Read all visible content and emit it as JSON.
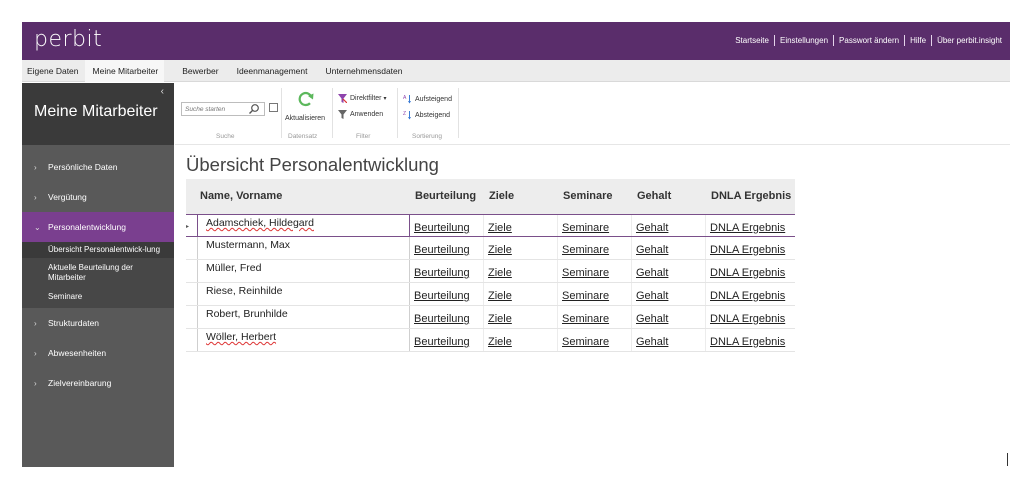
{
  "app": {
    "logo": "perbit",
    "top_links": [
      "Startseite",
      "Einstellungen",
      "Passwort ändern",
      "Hilfe",
      "Über perbit.insight"
    ]
  },
  "module_tabs": [
    {
      "label": "Eigene Daten",
      "active": false
    },
    {
      "label": "Meine Mitarbeiter",
      "active": true
    },
    {
      "label": "Bewerber",
      "active": false
    },
    {
      "label": "Ideenmanagement",
      "active": false
    },
    {
      "label": "Unternehmensdaten",
      "active": false
    }
  ],
  "sidebar": {
    "title": "Meine Mitarbeiter",
    "items": [
      {
        "label": "Persönliche Daten",
        "icon": "chevron-right"
      },
      {
        "label": "Vergütung",
        "icon": "chevron-right"
      },
      {
        "label": "Personalentwicklung",
        "icon": "chevron-down",
        "active": true
      },
      {
        "label": "Strukturdaten",
        "icon": "chevron-right"
      },
      {
        "label": "Abwesenheiten",
        "icon": "chevron-right"
      },
      {
        "label": "Zielvereinbarung",
        "icon": "chevron-right"
      }
    ],
    "subitems": [
      {
        "label": "Übersicht Personalentwick-lung",
        "active": true
      },
      {
        "label": "Aktuelle Beurteilung der Mitarbeiter",
        "active": false
      },
      {
        "label": "Seminare",
        "active": false
      }
    ]
  },
  "ribbon": {
    "search_placeholder": "Suche starten",
    "groups": {
      "search": "Suche",
      "record": "Datensatz",
      "filter": "Filter",
      "sort": "Sortierung"
    },
    "refresh_label": "Aktualisieren",
    "direct_filter_label": "Direktfilter",
    "apply_label": "Anwenden",
    "ascending_label": "Aufsteigend",
    "descending_label": "Absteigend"
  },
  "main": {
    "title": "Übersicht Personalentwicklung",
    "columns": [
      "Name, Vorname",
      "Beurteilung",
      "Ziele",
      "Seminare",
      "Gehalt",
      "DNLA Ergebnis"
    ],
    "rows": [
      {
        "name": "Adamschiek, Hildegard",
        "links": [
          "Beurteilung",
          "Ziele",
          "Seminare",
          "Gehalt",
          "DNLA Ergebnis"
        ]
      },
      {
        "name": "Mustermann, Max",
        "links": [
          "Beurteilung",
          "Ziele",
          "Seminare",
          "Gehalt",
          "DNLA Ergebnis"
        ]
      },
      {
        "name": "Müller, Fred",
        "links": [
          "Beurteilung",
          "Ziele",
          "Seminare",
          "Gehalt",
          "DNLA Ergebnis"
        ]
      },
      {
        "name": "Riese, Reinhilde",
        "links": [
          "Beurteilung",
          "Ziele",
          "Seminare",
          "Gehalt",
          "DNLA Ergebnis"
        ]
      },
      {
        "name": "Robert, Brunhilde",
        "links": [
          "Beurteilung",
          "Ziele",
          "Seminare",
          "Gehalt",
          "DNLA Ergebnis"
        ]
      },
      {
        "name": "Wöller, Herbert",
        "links": [
          "Beurteilung",
          "Ziele",
          "Seminare",
          "Gehalt",
          "DNLA Ergebnis"
        ]
      }
    ]
  },
  "colors": {
    "brand": "#5a2d6b",
    "sidebar": "#595959",
    "sidebar_active": "#7a3f8f"
  }
}
